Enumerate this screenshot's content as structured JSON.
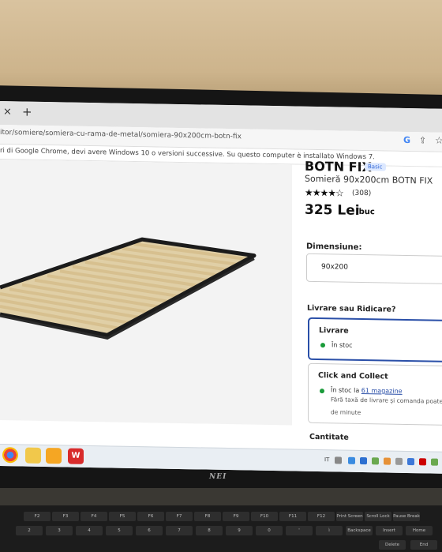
{
  "browser": {
    "tab_close": "×",
    "tab_new": "+",
    "url": "itor/somiere/somiera-cu-rama-de-metal/somiera-90x200cm-botn-fix",
    "google_label": "G",
    "infobar_text": "ri di Google Chrome, devi avere Windows 10 o versioni successive. Su questo computer è installato Windows 7."
  },
  "product": {
    "brand": "BOTN FIX",
    "badge": "Basic",
    "title": "Somieră 90x200cm BOTN FIX",
    "stars": "★★★★☆",
    "rating": 4,
    "reviews": "(308)",
    "price": "325 Lei",
    "unit": "/buc"
  },
  "dimension": {
    "label": "Dimensiune:",
    "value": "90x200"
  },
  "delivery": {
    "question": "Livrare sau Ridicare?",
    "option1": {
      "title": "Livrare",
      "stock": "În stoc"
    },
    "option2": {
      "title": "Click and Collect",
      "stock_prefix": "În stoc la ",
      "stock_link": "61 magazine",
      "note1": "Fără taxă de livrare și comanda poate fi",
      "note2": "de minute"
    }
  },
  "quantity_label": "Cantitate",
  "taskbar": {
    "lang": "IT"
  },
  "monitor_brand": "NEI",
  "colors": {
    "accent": "#2a4fa8",
    "in_stock": "#1a9b3a"
  },
  "keyboard": {
    "row1": [
      "F2",
      "F3",
      "F4",
      "F5",
      "F6",
      "F7",
      "F8",
      "F9",
      "F10",
      "F11",
      "F12",
      "Print Screen",
      "Scroll Lock",
      "Pause Break"
    ],
    "row2": [
      "2",
      "3",
      "4",
      "5",
      "6",
      "7",
      "8",
      "9",
      "0",
      "'",
      "ì",
      "Backspace",
      "Insert",
      "Home"
    ],
    "row3": [
      "Delete",
      "End"
    ]
  }
}
